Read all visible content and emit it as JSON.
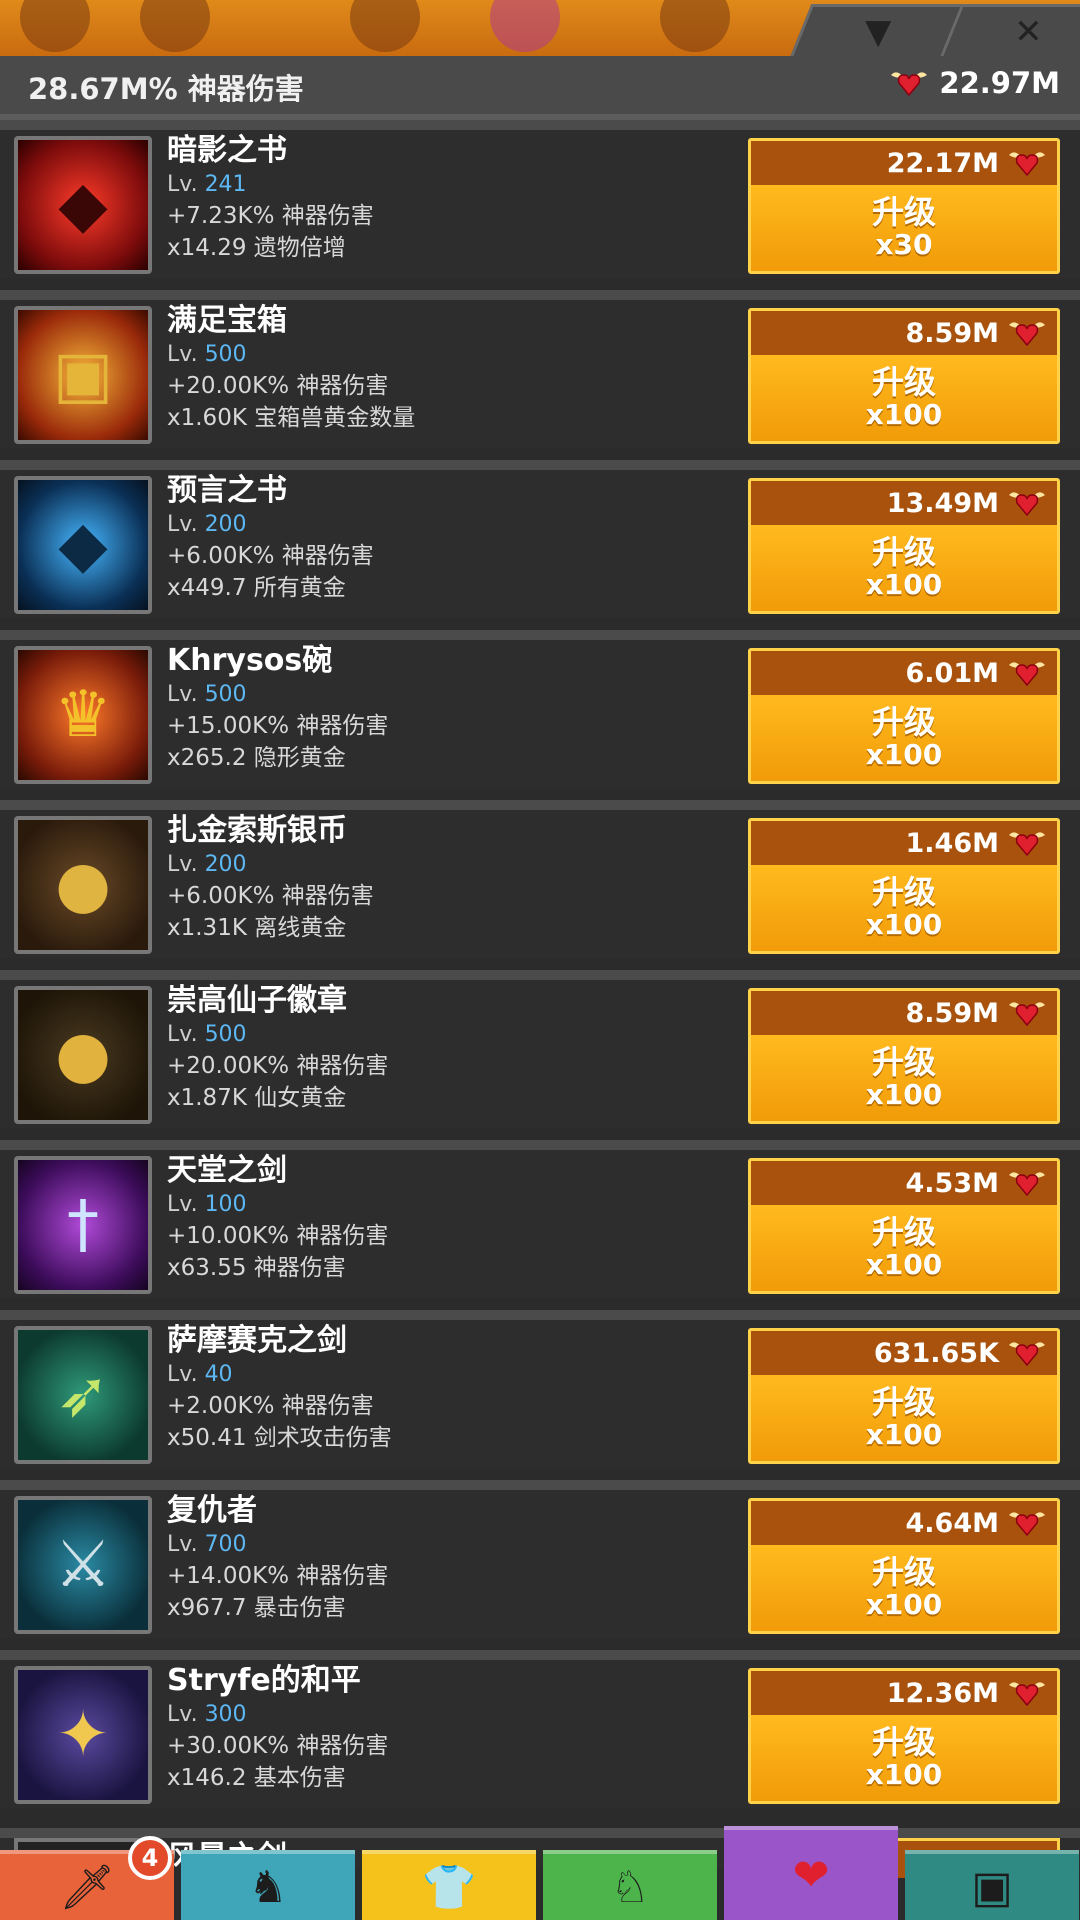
{
  "header": {
    "total_damage": "28.67M% 神器伤害",
    "currency": "22.97M"
  },
  "window": {
    "collapse_icon": "chevron-down-icon",
    "close_icon": "close-icon"
  },
  "artifacts": [
    {
      "name": "暗影之书",
      "lv_label": "Lv.",
      "level": "241",
      "bonus": "+7.23K% 神器伤害",
      "effect": "x14.29 遗物倍增",
      "cost": "22.17M",
      "action": "升级",
      "qty": "x30",
      "icon": "book-of-shadows-icon"
    },
    {
      "name": "满足宝箱",
      "lv_label": "Lv.",
      "level": "500",
      "bonus": "+20.00K% 神器伤害",
      "effect": "x1.60K 宝箱兽黄金数量",
      "cost": "8.59M",
      "action": "升级",
      "qty": "x100",
      "icon": "chest-icon"
    },
    {
      "name": "预言之书",
      "lv_label": "Lv.",
      "level": "200",
      "bonus": "+6.00K% 神器伤害",
      "effect": "x449.7 所有黄金",
      "cost": "13.49M",
      "action": "升级",
      "qty": "x100",
      "icon": "book-of-prophecy-icon"
    },
    {
      "name": "Khrysos碗",
      "lv_label": "Lv.",
      "level": "500",
      "bonus": "+15.00K% 神器伤害",
      "effect": "x265.2 隐形黄金",
      "cost": "6.01M",
      "action": "升级",
      "qty": "x100",
      "icon": "golden-bowl-icon"
    },
    {
      "name": "扎金索斯银币",
      "lv_label": "Lv.",
      "level": "200",
      "bonus": "+6.00K% 神器伤害",
      "effect": "x1.31K 离线黄金",
      "cost": "1.46M",
      "action": "升级",
      "qty": "x100",
      "icon": "coin-icon"
    },
    {
      "name": "崇高仙子徽章",
      "lv_label": "Lv.",
      "level": "500",
      "bonus": "+20.00K% 神器伤害",
      "effect": "x1.87K 仙女黄金",
      "cost": "8.59M",
      "action": "升级",
      "qty": "x100",
      "icon": "fairy-badge-icon"
    },
    {
      "name": "天堂之剑",
      "lv_label": "Lv.",
      "level": "100",
      "bonus": "+10.00K% 神器伤害",
      "effect": "x63.55 神器伤害",
      "cost": "4.53M",
      "action": "升级",
      "qty": "x100",
      "icon": "heaven-sword-icon"
    },
    {
      "name": "萨摩赛克之剑",
      "lv_label": "Lv.",
      "level": "40",
      "bonus": "+2.00K% 神器伤害",
      "effect": "x50.41 剑术攻击伤害",
      "cost": "631.65K",
      "action": "升级",
      "qty": "x100",
      "icon": "spear-icon"
    },
    {
      "name": "复仇者",
      "lv_label": "Lv.",
      "level": "700",
      "bonus": "+14.00K% 神器伤害",
      "effect": "x967.7 暴击伤害",
      "cost": "4.64M",
      "action": "升级",
      "qty": "x100",
      "icon": "avenger-sword-icon"
    },
    {
      "name": "Stryfe的和平",
      "lv_label": "Lv.",
      "level": "300",
      "bonus": "+30.00K% 神器伤害",
      "effect": "x146.2 基本伤害",
      "cost": "12.36M",
      "action": "升级",
      "qty": "x100",
      "icon": "stryfe-peace-icon"
    }
  ],
  "partial_row": {
    "name": "风暴之剑"
  },
  "nav": {
    "tabs": [
      {
        "id": "sword",
        "icon": "sword-icon",
        "color": "#e8623a"
      },
      {
        "id": "heroes",
        "icon": "viking-helmet-icon",
        "color": "#3fa6b9"
      },
      {
        "id": "equipment",
        "icon": "shirt-icon",
        "color": "#f4c21a"
      },
      {
        "id": "pets",
        "icon": "pet-icon",
        "color": "#4db34b"
      },
      {
        "id": "artifacts",
        "icon": "winged-heart-icon",
        "color": "#9a55c8"
      },
      {
        "id": "shop",
        "icon": "chest-icon",
        "color": "#2e8a82"
      }
    ],
    "sword_badge": "4"
  },
  "colors": {
    "accent_gold": "#f2a20c",
    "cost_bar": "#a9520d",
    "level_blue": "#5cb7f2"
  }
}
